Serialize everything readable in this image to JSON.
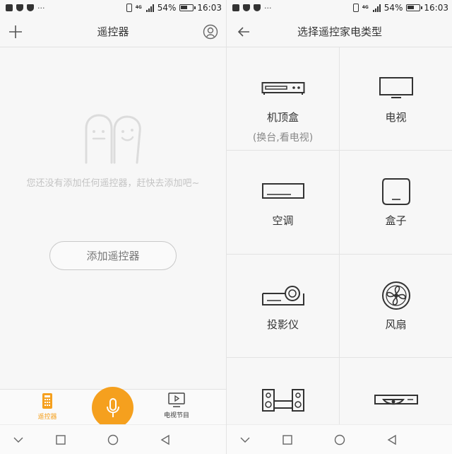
{
  "status_bar": {
    "network": "4G",
    "battery": "54%",
    "time": "16:03",
    "more": "···"
  },
  "left_screen": {
    "title": "遥控器",
    "add_icon": "plus-icon",
    "account_icon": "user-circle-icon",
    "empty_message": "您还没有添加任何遥控器，赶快去添加吧~",
    "add_button": "添加遥控器",
    "tabs": [
      {
        "label": "遥控器",
        "icon": "remote-icon",
        "active": true
      },
      {
        "label": "电视节目",
        "icon": "tv-play-icon",
        "active": false
      }
    ],
    "accent_color": "#f5a01e"
  },
  "right_screen": {
    "title": "选择遥控家电类型",
    "back_icon": "back-arrow-icon",
    "categories": [
      {
        "label": "机顶盒",
        "sub": "(换台,看电视)",
        "icon": "set-top-box-icon"
      },
      {
        "label": "电视",
        "sub": "",
        "icon": "tv-icon"
      },
      {
        "label": "空调",
        "sub": "",
        "icon": "air-conditioner-icon"
      },
      {
        "label": "盒子",
        "sub": "",
        "icon": "box-icon"
      },
      {
        "label": "投影仪",
        "sub": "",
        "icon": "projector-icon"
      },
      {
        "label": "风扇",
        "sub": "",
        "icon": "fan-icon"
      },
      {
        "label": "",
        "sub": "",
        "icon": "audio-system-icon"
      },
      {
        "label": "",
        "sub": "",
        "icon": "dvd-player-icon"
      }
    ]
  },
  "nav_bar": [
    "back-chevron-icon",
    "recent-apps-icon",
    "home-icon",
    "back-triangle-icon"
  ]
}
